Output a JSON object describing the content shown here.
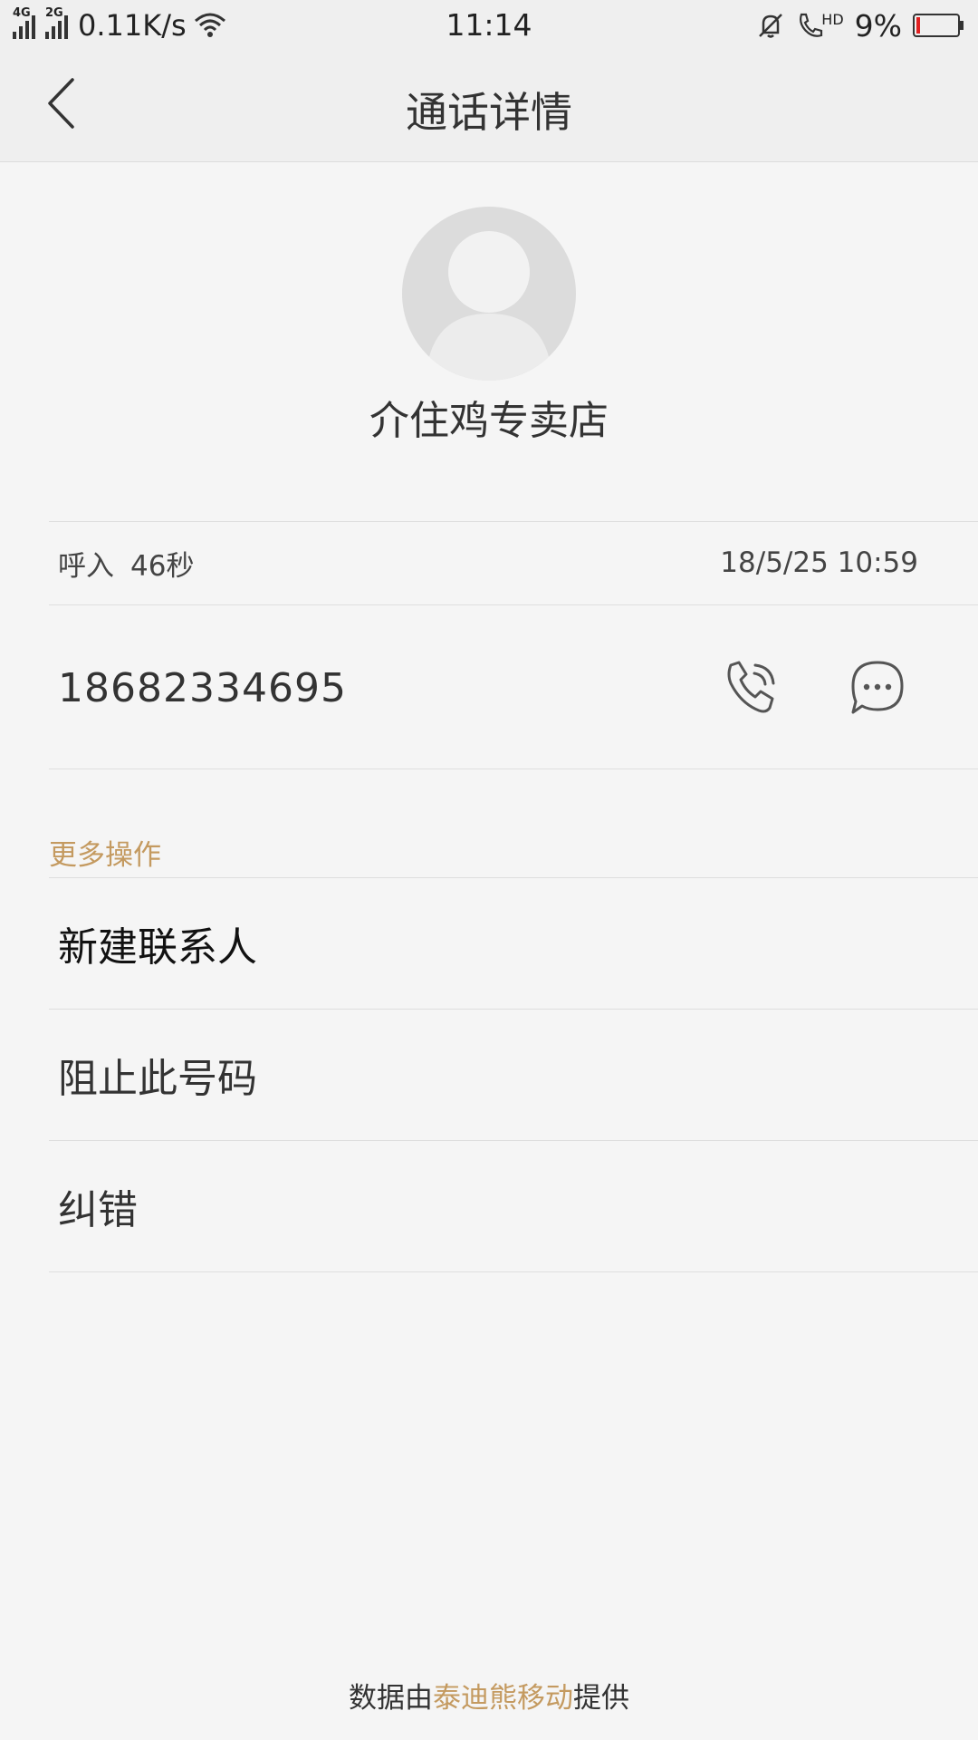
{
  "status_bar": {
    "net1": "4G",
    "net2": "2G",
    "speed": "0.11K/s",
    "time": "11:14",
    "hd": "HD",
    "battery": "9%",
    "battery_level": 0.09,
    "battery_color": "#e02020"
  },
  "nav": {
    "title": "通话详情",
    "back_icon": "chevron-left-icon"
  },
  "contact": {
    "name": "介住鸡专卖店",
    "avatar_icon": "person-avatar-icon"
  },
  "call_record": {
    "direction": "呼入",
    "duration": "46秒",
    "datetime": "18/5/25 10:59"
  },
  "number": {
    "value": "18682334695",
    "call_icon": "phone-icon",
    "message_icon": "chat-bubble-icon"
  },
  "more": {
    "label": "更多操作",
    "items": [
      {
        "label": "新建联系人"
      },
      {
        "label": "阻止此号码"
      },
      {
        "label": "纠错"
      }
    ]
  },
  "footer": {
    "prefix": "数据由",
    "brand": "泰迪熊移动",
    "suffix": "提供"
  },
  "colors": {
    "accent": "#c49a60",
    "background": "#f5f5f5",
    "header": "#efefef"
  }
}
